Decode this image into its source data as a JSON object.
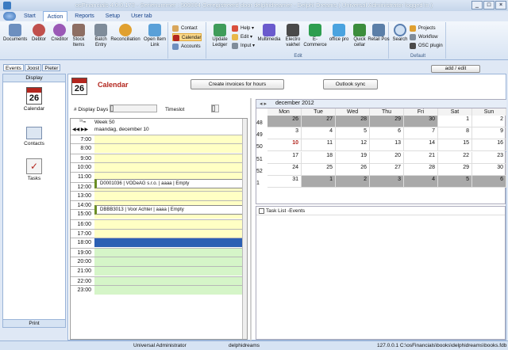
{
  "window": {
    "title": "osFinancials 4.0.0.173 - Serienummer : 500004 Geregistreerd door delphidreamer - Delphi Dreams ( Universal Administrator logged in )"
  },
  "menu_tabs": [
    "Start",
    "Action",
    "Reports",
    "Setup",
    "User tab"
  ],
  "ribbon": {
    "main_buttons": [
      "Documents",
      "Debtor",
      "Creditor",
      "Stock Items",
      "Batch Entry",
      "Reconciliation",
      "Open Item Link"
    ],
    "contact_group": [
      "Contact",
      "Calendar",
      "Accounts"
    ],
    "edit_group": {
      "update_ledger": "Update Ledger",
      "small": [
        "Help",
        "Edit",
        "Input"
      ],
      "buttons": [
        "Multimedia",
        "Electro vakhel",
        "E-Commerce",
        "office pro",
        "Quick cellar",
        "Retail Pos"
      ],
      "label": "Edit"
    },
    "default_group": {
      "search": "Search",
      "small": [
        "Projects",
        "Workflow",
        "OSC plugin"
      ],
      "label": "Default"
    }
  },
  "subtabs": [
    "Events",
    "Joost",
    "Pieter"
  ],
  "add_edit_button": "add / edit",
  "left_panel": {
    "header": "Display",
    "date_icon_number": "26",
    "items": [
      "Calendar",
      "Contacts",
      "Tasks"
    ],
    "footer": "Print"
  },
  "calendar": {
    "title": "Calendar",
    "date_icon_number": "26",
    "create_invoices_button": "Create invoices for hours",
    "outlook_sync_button": "Outlook sync",
    "display_days_label": "# Display Days",
    "timeslot_label": "Timeslot",
    "week_label": "Week  50",
    "day_label": "maandag, december 10",
    "hours": [
      "7:00",
      "8:00",
      "9:00",
      "10:00",
      "11:00",
      "12:00",
      "13:00",
      "14:00",
      "15:00",
      "16:00",
      "17:00",
      "18:00",
      "19:00",
      "20:00",
      "21:00",
      "22:00",
      "23:00"
    ],
    "appointments": [
      {
        "text": "D0001036 | VODeAG s.r.o. | aaaa | Empty"
      },
      {
        "text": "DBBB3013 | Voor Achter | aaaa | Empty"
      }
    ]
  },
  "month_view": {
    "title": "december 2012",
    "days_of_week": [
      "Mon",
      "Tue",
      "Wed",
      "Thu",
      "Fri",
      "Sat",
      "Sun"
    ],
    "weeks": [
      {
        "week": "48",
        "days": [
          "26",
          "27",
          "28",
          "29",
          "30",
          "1",
          "2"
        ],
        "other": [
          true,
          true,
          true,
          true,
          true,
          false,
          false
        ]
      },
      {
        "week": "49",
        "days": [
          "3",
          "4",
          "5",
          "6",
          "7",
          "8",
          "9"
        ],
        "other": [
          false,
          false,
          false,
          false,
          false,
          false,
          false
        ]
      },
      {
        "week": "50",
        "days": [
          "10",
          "11",
          "12",
          "13",
          "14",
          "15",
          "16"
        ],
        "other": [
          false,
          false,
          false,
          false,
          false,
          false,
          false
        ]
      },
      {
        "week": "51",
        "days": [
          "17",
          "18",
          "19",
          "20",
          "21",
          "22",
          "23"
        ],
        "other": [
          false,
          false,
          false,
          false,
          false,
          false,
          false
        ]
      },
      {
        "week": "52",
        "days": [
          "24",
          "25",
          "26",
          "27",
          "28",
          "29",
          "30"
        ],
        "other": [
          false,
          false,
          false,
          false,
          false,
          false,
          false
        ]
      },
      {
        "week": "1",
        "days": [
          "31",
          "1",
          "2",
          "3",
          "4",
          "5",
          "6"
        ],
        "other": [
          false,
          true,
          true,
          true,
          true,
          true,
          true
        ]
      }
    ]
  },
  "task_list": {
    "header": "Task List -Events"
  },
  "statusbar": {
    "user": "Universal Administrator",
    "company": "delphidreams",
    "path": "127.0.0.1 C:\\osFinancials\\books\\delphidreams\\books.fdb"
  },
  "colors": {
    "accent": "#b3261e",
    "ribbon_blue": "#15428b",
    "selected_slot": "#2b5fb3",
    "slot_green": "#d5f5c8",
    "slot_yellow": "#ffffc4"
  }
}
